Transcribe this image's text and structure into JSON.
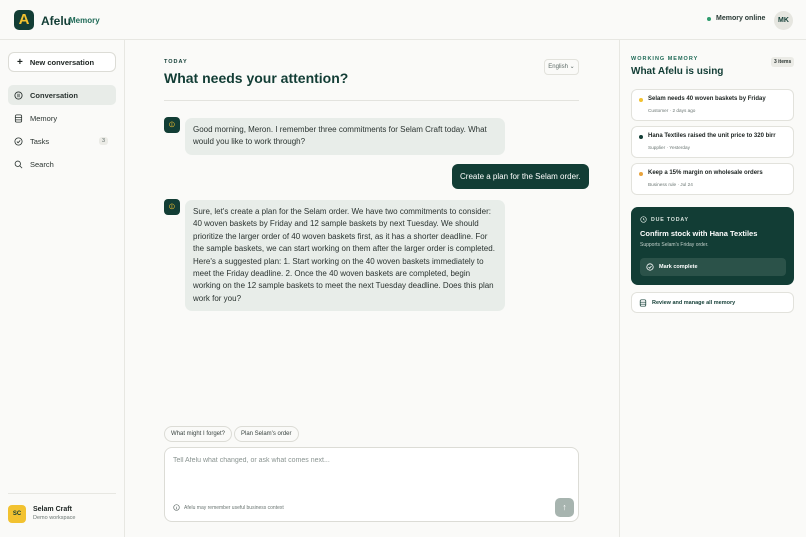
{
  "header": {
    "logo_letter": "A",
    "brand": "Afelu",
    "brand_sub": "Memory",
    "status": "Memory online",
    "user_initials": "MK"
  },
  "sidebar": {
    "new_conversation": "New conversation",
    "items": [
      {
        "label": "Conversation",
        "icon": "chat-icon",
        "active": true
      },
      {
        "label": "Memory",
        "icon": "database-icon"
      },
      {
        "label": "Tasks",
        "icon": "check-circle-icon",
        "count": "3"
      },
      {
        "label": "Search",
        "icon": "search-icon"
      }
    ],
    "workspace": {
      "initials": "SC",
      "name": "Selam Craft",
      "sub": "Demo workspace"
    }
  },
  "main": {
    "eyebrow": "TODAY",
    "title": "What needs your attention?",
    "language": "English",
    "messages": [
      {
        "role": "assistant",
        "text": "Good morning, Meron. I remember three commitments for Selam Craft today. What would you like to work through?"
      },
      {
        "role": "user",
        "text": "Create a plan for the Selam order."
      },
      {
        "role": "assistant",
        "text": "Sure, let's create a plan for the Selam order. We have two commitments to consider: 40 woven baskets by Friday and 12 sample baskets by next Tuesday. We should prioritize the larger order of 40 woven baskets first, as it has a shorter deadline. For the sample baskets, we can start working on them after the larger order is completed. Here's a suggested plan: 1. Start working on the 40 woven baskets immediately to meet the Friday deadline. 2. Once the 40 woven baskets are completed, begin working on the 12 sample baskets to meet the next Tuesday deadline. Does this plan work for you?"
      }
    ],
    "suggestions": [
      "What might I forget?",
      "Plan Selam's order"
    ],
    "composer": {
      "placeholder": "Tell Afelu what changed, or ask what comes next...",
      "hint": "Afelu may remember useful business context"
    }
  },
  "panel": {
    "eyebrow": "WORKING MEMORY",
    "title": "What Afelu is using",
    "count": "3 items",
    "memories": [
      {
        "title": "Selam needs 40 woven baskets by Friday",
        "sub": "Customer · 2 days ago",
        "color": "#f2c230"
      },
      {
        "title": "Hana Textiles raised the unit price to 320 birr",
        "sub": "Supplier · Yesterday",
        "color": "#123d35"
      },
      {
        "title": "Keep a 15% margin on wholesale orders",
        "sub": "Business rule · Jul 24",
        "color": "#e8a33d"
      }
    ],
    "due": {
      "label": "DUE TODAY",
      "title": "Confirm stock with Hana Textiles",
      "sub": "Supports Selam's Friday order.",
      "button": "Mark complete"
    },
    "review": "Review and manage all memory"
  },
  "colors": {
    "brand": "#123d35",
    "accent": "#f2c230",
    "online": "#2f9c6e"
  }
}
